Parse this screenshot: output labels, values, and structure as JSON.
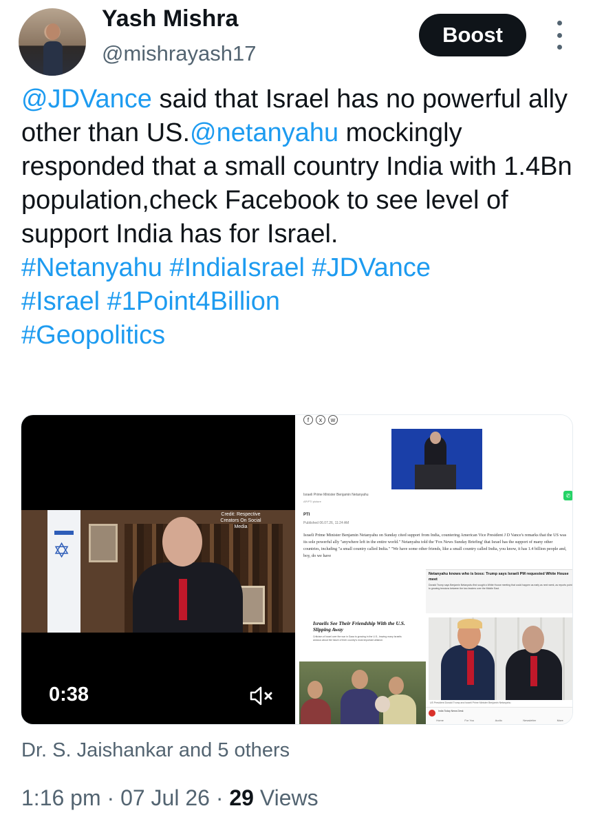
{
  "author": {
    "name": "Yash Mishra",
    "handle": "@mishrayash17"
  },
  "boost_label": "Boost",
  "tweet": {
    "mention1": "@JDVance",
    "text1": " said that Israel has no powerful ally other than US.",
    "mention2": "@netanyahu",
    "text2": " mockingly responded that a small country India with 1.4Bn population,check Facebook to see level of support India has for Israel.",
    "hashtags_line1": "#Netanyahu #IndiaIsrael #JDVance",
    "hashtags_line2": "#Israel #1Point4Billion",
    "hashtags_line3": "#Geopolitics"
  },
  "video": {
    "credit": "Credit: Respective Creators On Social Media",
    "timer": "0:38"
  },
  "article": {
    "social_icons": [
      "f",
      "x",
      "w"
    ],
    "photo_caption": "Israeli Prime Minister Benjamin Netanyahu",
    "photo_credit": "AP/PTI picture",
    "agency": "PTI",
    "published": "Published 06.07.26, 11:24 AM",
    "body": "Israeli Prime Minister Benjamin Netanyahu on Sunday cited support from India, countering American Vice President J D Vance's remarks that the US was its sole powerful ally \"anywhere left in the entire world.\" Netanyahu told the 'Fox News Sunday Briefing' that Israel has the support of many other countries, including \"a small country called India.\" \"We have some other friends, like a small country called India, you know, it has 1.4 billion people and, boy, do we have",
    "notif_title": "Netanyahu knows who is boss: Trump says Israeli PM requested White House meet",
    "notif_body": "Donald Trump says Benjamin Netanyahu first sought a White House meeting that could happen as early as next week, as reports point to growing tensions between the two leaders over the Middle East.",
    "nyt_title": "Israelis See Their Friendship With the U.S. Slipping Away",
    "nyt_body": "Criticism of Israel over the war in Gaza is growing in the U.S., leaving many Israelis anxious about the future of their country's most important alliance.",
    "trump_caption": "US President Donald Trump and Israeli Prime Minister Benjamin Netanyahu",
    "app_name": "India Today News Desk",
    "nav": [
      "Home",
      "For You",
      "Audio",
      "Newsletter",
      "More"
    ]
  },
  "likers": "Dr. S. Jaishankar and 5 others",
  "meta": {
    "time": "1:16 pm",
    "date": "07 Jul 26",
    "views_count": "29",
    "views_label": "Views"
  }
}
